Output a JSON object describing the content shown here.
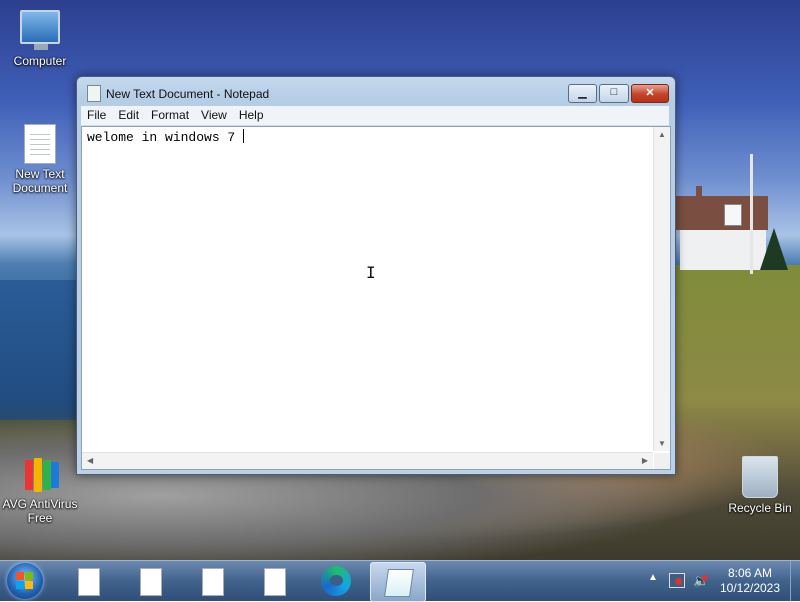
{
  "desktop": {
    "icons": [
      {
        "label": "Computer",
        "icon": "computer-icon"
      },
      {
        "label": "New Text\nDocument",
        "icon": "text-document-icon"
      },
      {
        "label": "AVG AntiVirus\nFree",
        "icon": "avg-antivirus-icon"
      },
      {
        "label": "Recycle Bin",
        "icon": "recycle-bin-icon"
      }
    ]
  },
  "window": {
    "title": "New Text Document - Notepad",
    "menu": [
      "File",
      "Edit",
      "Format",
      "View",
      "Help"
    ],
    "content": "welome in windows 7 ",
    "buttons": {
      "minimize": "minimize-icon",
      "maximize": "maximize-icon",
      "close": "close-icon"
    }
  },
  "taskbar": {
    "start": "windows-start-icon",
    "buttons": [
      {
        "icon": "document-icon",
        "active": false
      },
      {
        "icon": "document-icon",
        "active": false
      },
      {
        "icon": "document-icon",
        "active": false
      },
      {
        "icon": "document-icon",
        "active": false
      },
      {
        "icon": "edge-icon",
        "active": false
      },
      {
        "icon": "notepad-icon",
        "active": true
      }
    ],
    "tray": {
      "time": "8:06 AM",
      "date": "10/12/2023"
    }
  }
}
